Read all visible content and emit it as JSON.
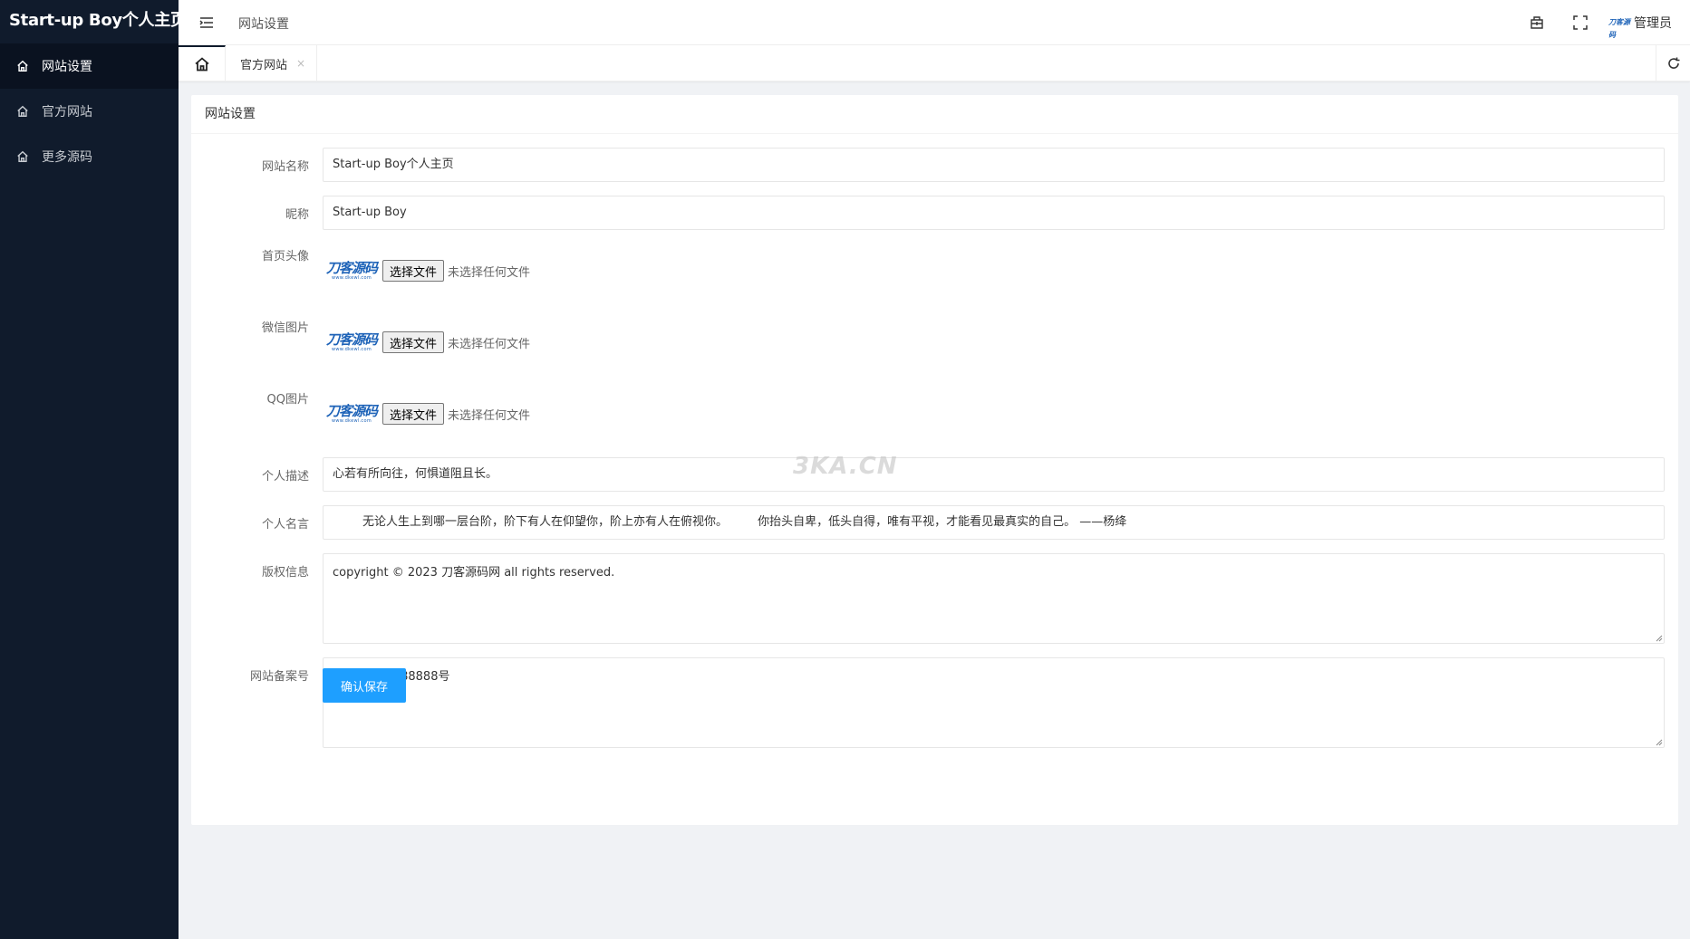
{
  "sidebar": {
    "logo": "Start-up Boy个人主页",
    "items": [
      {
        "label": "网站设置",
        "icon": "home-icon",
        "active": true
      },
      {
        "label": "官方网站",
        "icon": "home-icon",
        "active": false
      },
      {
        "label": "更多源码",
        "icon": "home-icon",
        "active": false
      }
    ]
  },
  "header": {
    "title": "网站设置",
    "admin_logo": "刀客源码",
    "admin_name": "管理员"
  },
  "tabs": {
    "items": [
      {
        "label": "官方网站",
        "close": "×"
      }
    ]
  },
  "card": {
    "title": "网站设置"
  },
  "form": {
    "site_name": {
      "label": "网站名称",
      "value": "Start-up Boy个人主页"
    },
    "nickname": {
      "label": "昵称",
      "value": "Start-up Boy"
    },
    "avatar": {
      "label": "首页头像",
      "thumb_brand": "刀客源码",
      "thumb_url": "www.dkewl.com",
      "button": "选择文件",
      "status": "未选择任何文件"
    },
    "wechat": {
      "label": "微信图片",
      "thumb_brand": "刀客源码",
      "thumb_url": "www.dkewl.com",
      "button": "选择文件",
      "status": "未选择任何文件"
    },
    "qq": {
      "label": "QQ图片",
      "thumb_brand": "刀客源码",
      "thumb_url": "www.dkewl.com",
      "button": "选择文件",
      "status": "未选择任何文件"
    },
    "description": {
      "label": "个人描述",
      "value": "心若有所向往，何惧道阻且长。"
    },
    "motto": {
      "label": "个人名言",
      "value": "        无论人生上到哪一层台阶，阶下有人在仰望你，阶上亦有人在俯视你。        你抬头自卑，低头自得，唯有平视，才能看见最真实的自己。 ——杨绛"
    },
    "copyright": {
      "label": "版权信息",
      "value": "copyright © 2023 刀客源码网 all rights reserved."
    },
    "icp": {
      "label": "网站备案号",
      "value": "ICP备8888888888号"
    },
    "save_label": "确认保存"
  },
  "watermark": "3KA.CN",
  "colors": {
    "sidebar_bg": "#101b2c",
    "primary_button": "#1e9fff",
    "page_bg": "#f0f2f5"
  }
}
